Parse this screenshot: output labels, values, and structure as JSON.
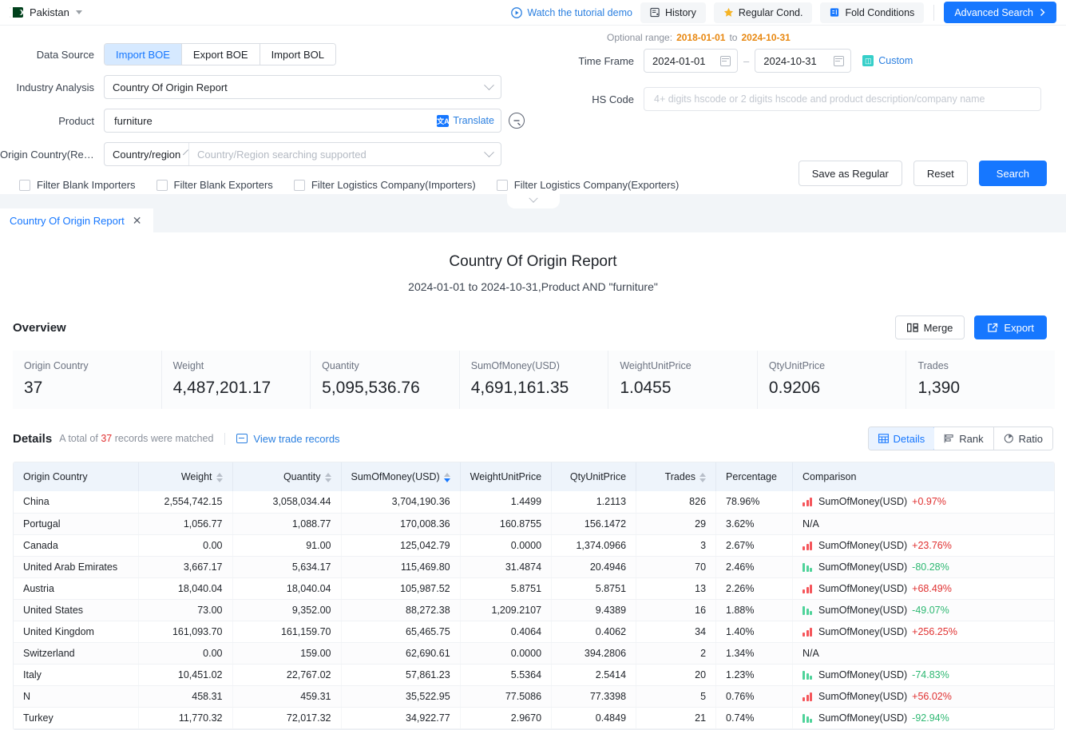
{
  "topbar": {
    "country": "Pakistan",
    "tutorial_link": "Watch the tutorial demo",
    "history": "History",
    "regular_cond": "Regular Cond.",
    "fold_conditions": "Fold Conditions",
    "advanced_search": "Advanced Search",
    "accent": "#1677ff"
  },
  "search": {
    "data_source_label": "Data Source",
    "data_sources": [
      {
        "label": "Import BOE",
        "active": true
      },
      {
        "label": "Export BOE",
        "active": false
      },
      {
        "label": "Import BOL",
        "active": false
      }
    ],
    "industry_label": "Industry Analysis",
    "industry_value": "Country Of Origin Report",
    "product_label": "Product",
    "product_value": "furniture",
    "product_placeholder": "",
    "translate_label": "Translate",
    "origin_label": "Origin Country(Regi...",
    "origin_type": "Country/region",
    "origin_placeholder": "Country/Region searching supported",
    "optional_range_label": "Optional range:",
    "optional_range_from": "2018-01-01",
    "optional_range_to_word": "to",
    "optional_range_to": "2024-10-31",
    "time_frame_label": "Time Frame",
    "date_from": "2024-01-01",
    "date_to": "2024-10-31",
    "custom_label": "Custom",
    "hs_label": "HS Code",
    "hs_value": "",
    "hs_placeholder": "4+ digits hscode or 2 digits hscode and product description/company name",
    "filters": [
      "Filter Blank Importers",
      "Filter Blank Exporters",
      "Filter Logistics Company(Importers)",
      "Filter Logistics Company(Exporters)"
    ],
    "save_as_regular": "Save as Regular",
    "reset": "Reset",
    "search": "Search"
  },
  "tabs": [
    {
      "label": "Country Of Origin Report",
      "active": true,
      "close": "✕"
    }
  ],
  "report": {
    "title": "Country Of Origin Report",
    "subtitle": "2024-01-01 to 2024-10-31,Product AND \"furniture\"",
    "overview_title": "Overview",
    "merge_label": "Merge",
    "export_label": "Export",
    "stats": [
      {
        "label": "Origin Country",
        "value": "37"
      },
      {
        "label": "Weight",
        "value": "4,487,201.17"
      },
      {
        "label": "Quantity",
        "value": "5,095,536.76"
      },
      {
        "label": "SumOfMoney(USD)",
        "value": "4,691,161.35"
      },
      {
        "label": "WeightUnitPrice",
        "value": "1.0455"
      },
      {
        "label": "QtyUnitPrice",
        "value": "0.9206"
      },
      {
        "label": "Trades",
        "value": "1,390"
      }
    ],
    "details_title": "Details",
    "details_prefix": "A total of",
    "details_count": "37",
    "details_suffix": "records were matched",
    "view_trade_records": "View trade records",
    "modes": [
      {
        "label": "Details",
        "active": true
      },
      {
        "label": "Rank",
        "active": false
      },
      {
        "label": "Ratio",
        "active": false
      }
    ]
  },
  "table": {
    "columns": [
      {
        "label": "Origin Country",
        "align": "left",
        "sortable": false
      },
      {
        "label": "Weight",
        "align": "right",
        "sortable": true
      },
      {
        "label": "Quantity",
        "align": "right",
        "sortable": true
      },
      {
        "label": "SumOfMoney(USD)",
        "align": "right",
        "sortable": true,
        "sorted": "desc"
      },
      {
        "label": "WeightUnitPrice",
        "align": "right",
        "sortable": false
      },
      {
        "label": "QtyUnitPrice",
        "align": "right",
        "sortable": false
      },
      {
        "label": "Trades",
        "align": "right",
        "sortable": true
      },
      {
        "label": "Percentage",
        "align": "left",
        "sortable": false
      },
      {
        "label": "Comparison",
        "align": "left",
        "sortable": false
      }
    ],
    "comparison_metric": "SumOfMoney(USD)",
    "na_text": "N/A",
    "rows": [
      {
        "country": "China",
        "weight": "2,554,742.15",
        "quantity": "3,058,034.44",
        "sum": "3,704,190.36",
        "wup": "1.4499",
        "qup": "1.2113",
        "trades": "826",
        "pct": "78.96%",
        "cmp_dir": "up",
        "cmp_val": "+0.97%"
      },
      {
        "country": "Portugal",
        "weight": "1,056.77",
        "quantity": "1,088.77",
        "sum": "170,008.36",
        "wup": "160.8755",
        "qup": "156.1472",
        "trades": "29",
        "pct": "3.62%",
        "cmp_dir": "na",
        "cmp_val": ""
      },
      {
        "country": "Canada",
        "weight": "0.00",
        "quantity": "91.00",
        "sum": "125,042.79",
        "wup": "0.0000",
        "qup": "1,374.0966",
        "trades": "3",
        "pct": "2.67%",
        "cmp_dir": "up",
        "cmp_val": "+23.76%"
      },
      {
        "country": "United Arab Emirates",
        "weight": "3,667.17",
        "quantity": "5,634.17",
        "sum": "115,469.80",
        "wup": "31.4874",
        "qup": "20.4946",
        "trades": "70",
        "pct": "2.46%",
        "cmp_dir": "down",
        "cmp_val": "-80.28%"
      },
      {
        "country": "Austria",
        "weight": "18,040.04",
        "quantity": "18,040.04",
        "sum": "105,987.52",
        "wup": "5.8751",
        "qup": "5.8751",
        "trades": "13",
        "pct": "2.26%",
        "cmp_dir": "up",
        "cmp_val": "+68.49%"
      },
      {
        "country": "United States",
        "weight": "73.00",
        "quantity": "9,352.00",
        "sum": "88,272.38",
        "wup": "1,209.2107",
        "qup": "9.4389",
        "trades": "16",
        "pct": "1.88%",
        "cmp_dir": "down",
        "cmp_val": "-49.07%"
      },
      {
        "country": "United Kingdom",
        "weight": "161,093.70",
        "quantity": "161,159.70",
        "sum": "65,465.75",
        "wup": "0.4064",
        "qup": "0.4062",
        "trades": "34",
        "pct": "1.40%",
        "cmp_dir": "up",
        "cmp_val": "+256.25%"
      },
      {
        "country": "Switzerland",
        "weight": "0.00",
        "quantity": "159.00",
        "sum": "62,690.61",
        "wup": "0.0000",
        "qup": "394.2806",
        "trades": "2",
        "pct": "1.34%",
        "cmp_dir": "na",
        "cmp_val": ""
      },
      {
        "country": "Italy",
        "weight": "10,451.02",
        "quantity": "22,767.02",
        "sum": "57,861.23",
        "wup": "5.5364",
        "qup": "2.5414",
        "trades": "20",
        "pct": "1.23%",
        "cmp_dir": "down",
        "cmp_val": "-74.83%"
      },
      {
        "country": "N",
        "weight": "458.31",
        "quantity": "459.31",
        "sum": "35,522.95",
        "wup": "77.5086",
        "qup": "77.3398",
        "trades": "5",
        "pct": "0.76%",
        "cmp_dir": "up",
        "cmp_val": "+56.02%"
      },
      {
        "country": "Turkey",
        "weight": "11,770.32",
        "quantity": "72,017.32",
        "sum": "34,922.77",
        "wup": "2.9670",
        "qup": "0.4849",
        "trades": "21",
        "pct": "0.74%",
        "cmp_dir": "down",
        "cmp_val": "-92.94%"
      }
    ]
  }
}
